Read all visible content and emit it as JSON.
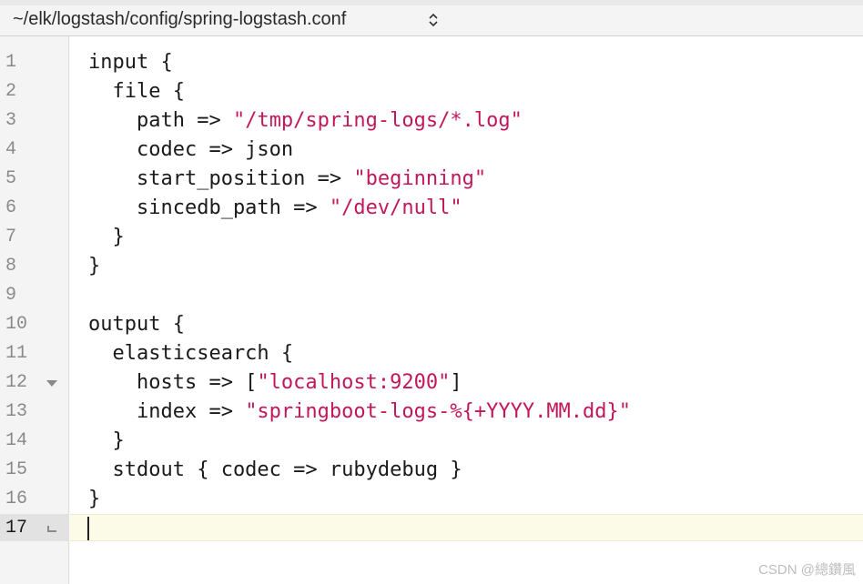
{
  "title_bar": {
    "file_path": "~/elk/logstash/config/spring-logstash.conf",
    "selector_icon": "up-down-chevron-icon"
  },
  "editor": {
    "current_line": 17,
    "fold_markers": {
      "12": "fold-triangle-icon",
      "17": "fold-end-icon"
    },
    "string_color": "#c2185b",
    "lines": [
      {
        "n": "1",
        "segments": [
          {
            "t": "input {",
            "s": false
          }
        ]
      },
      {
        "n": "2",
        "segments": [
          {
            "t": "  file {",
            "s": false
          }
        ]
      },
      {
        "n": "3",
        "segments": [
          {
            "t": "    path => ",
            "s": false
          },
          {
            "t": "\"/tmp/spring-logs/*.log\"",
            "s": true
          }
        ]
      },
      {
        "n": "4",
        "segments": [
          {
            "t": "    codec => json",
            "s": false
          }
        ]
      },
      {
        "n": "5",
        "segments": [
          {
            "t": "    start_position => ",
            "s": false
          },
          {
            "t": "\"beginning\"",
            "s": true
          }
        ]
      },
      {
        "n": "6",
        "segments": [
          {
            "t": "    sincedb_path => ",
            "s": false
          },
          {
            "t": "\"/dev/null\"",
            "s": true
          }
        ]
      },
      {
        "n": "7",
        "segments": [
          {
            "t": "  }",
            "s": false
          }
        ]
      },
      {
        "n": "8",
        "segments": [
          {
            "t": "}",
            "s": false
          }
        ]
      },
      {
        "n": "9",
        "segments": [
          {
            "t": "",
            "s": false
          }
        ]
      },
      {
        "n": "10",
        "segments": [
          {
            "t": "output {",
            "s": false
          }
        ]
      },
      {
        "n": "11",
        "segments": [
          {
            "t": "  elasticsearch {",
            "s": false
          }
        ]
      },
      {
        "n": "12",
        "segments": [
          {
            "t": "    hosts => [",
            "s": false
          },
          {
            "t": "\"localhost:9200\"",
            "s": true
          },
          {
            "t": "]",
            "s": false
          }
        ]
      },
      {
        "n": "13",
        "segments": [
          {
            "t": "    index => ",
            "s": false
          },
          {
            "t": "\"springboot-logs-%{+YYYY.MM.dd}\"",
            "s": true
          }
        ]
      },
      {
        "n": "14",
        "segments": [
          {
            "t": "  }",
            "s": false
          }
        ]
      },
      {
        "n": "15",
        "segments": [
          {
            "t": "  stdout { codec => rubydebug }",
            "s": false
          }
        ]
      },
      {
        "n": "16",
        "segments": [
          {
            "t": "}",
            "s": false
          }
        ]
      },
      {
        "n": "17",
        "segments": [
          {
            "t": "",
            "s": false
          }
        ]
      }
    ]
  },
  "watermark": "CSDN @總鑽風"
}
